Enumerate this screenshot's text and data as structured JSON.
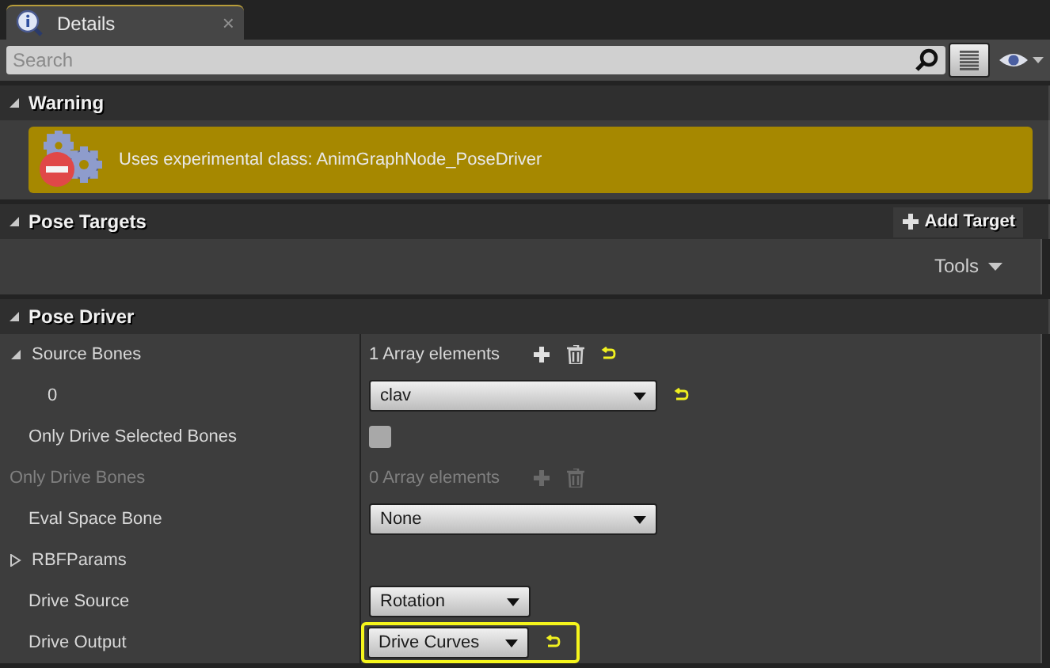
{
  "tab": {
    "title": "Details",
    "close": "×"
  },
  "search": {
    "placeholder": "Search"
  },
  "sections": [
    {
      "kind": "warning",
      "title": "Warning",
      "expanded": true,
      "message": "Uses experimental class: AnimGraphNode_PoseDriver"
    },
    {
      "kind": "targets",
      "title": "Pose Targets",
      "expanded": true,
      "button": "Add Target",
      "tools": "Tools"
    },
    {
      "kind": "properties",
      "title": "Pose Driver",
      "expanded": true,
      "rows": [
        {
          "label": "Source Bones",
          "kind": "array",
          "expanded": true,
          "count": "1 Array elements",
          "disabled": false,
          "reset": true,
          "children": [
            {
              "label": "0",
              "kind": "bone",
              "value": "clav",
              "reset": true,
              "highlighted": false
            }
          ]
        },
        {
          "label": "Only Drive Selected Bones",
          "kind": "checkbox",
          "checked": false
        },
        {
          "label": "Only Drive Bones",
          "kind": "array",
          "count": "0 Array elements",
          "disabled": true,
          "reset": false
        },
        {
          "label": "Eval Space Bone",
          "kind": "bone",
          "value": "None",
          "reset": false,
          "highlighted": false
        },
        {
          "label": "RBFParams",
          "kind": "group",
          "expanded": false
        },
        {
          "label": "Drive Source",
          "kind": "enum",
          "value": "Rotation",
          "reset": false,
          "highlighted": false
        },
        {
          "label": "Drive Output",
          "kind": "enum",
          "value": "Drive Curves",
          "reset": true,
          "highlighted": true
        }
      ]
    }
  ]
}
